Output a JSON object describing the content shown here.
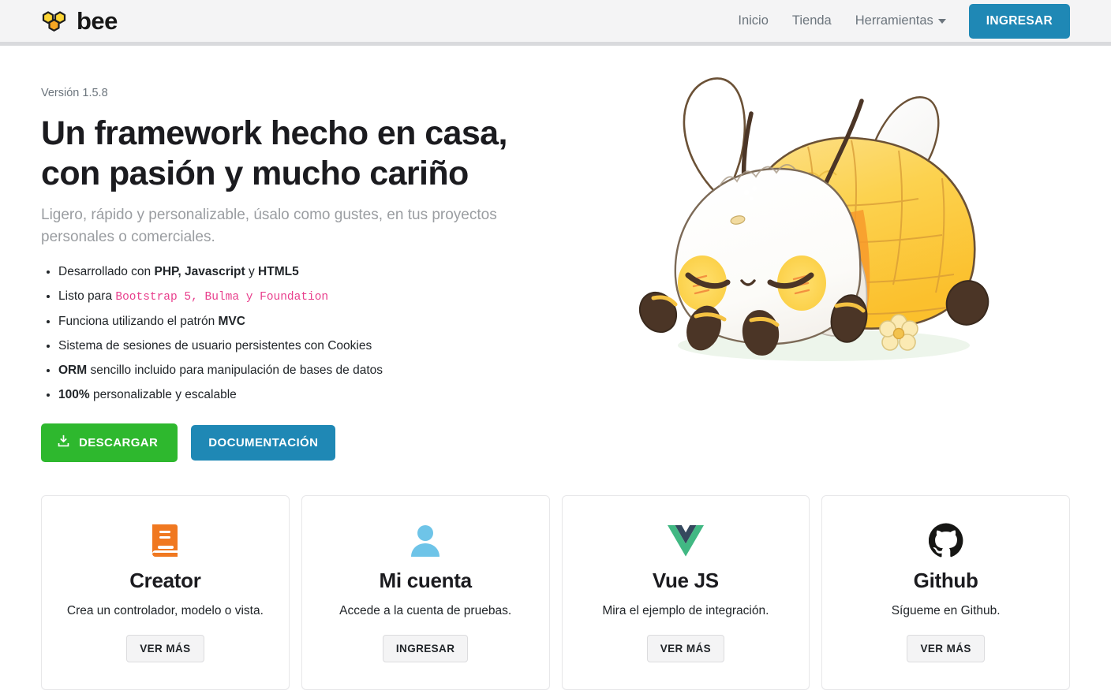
{
  "header": {
    "brand": "bee",
    "brand_logo_icon": "honeycomb-icon",
    "nav": [
      {
        "label": "Inicio"
      },
      {
        "label": "Tienda"
      },
      {
        "label": "Herramientas",
        "has_dropdown": true
      }
    ],
    "login_button": "INGRESAR",
    "login_color": "#1f88b5",
    "background": "#f4f4f5"
  },
  "hero": {
    "version": "Versión 1.5.8",
    "title": "Un framework hecho en casa, con pasión y mucho cariño",
    "subtitle": "Ligero, rápido y personalizable, úsalo como gustes, en tus proyectos personales o comerciales.",
    "features": [
      {
        "before": "Desarrollado con ",
        "bold": "PHP, Javascript",
        "middle": " y ",
        "bold2": "HTML5",
        "after": ""
      },
      {
        "before": "Listo para ",
        "code": "Bootstrap 5, Bulma y Foundation",
        "after": ""
      },
      {
        "before": "Funciona utilizando el patrón ",
        "bold": "MVC",
        "after": ""
      },
      {
        "before": "Sistema de sesiones de usuario persistentes con Cookies",
        "after": ""
      },
      {
        "bold": "ORM",
        "after": " sencillo incluido para manipulación de bases de datos"
      },
      {
        "bold": "100%",
        "after": " personalizable y escalable"
      }
    ],
    "download_button": "DESCARGAR",
    "download_icon": "download-icon",
    "download_color": "#2eb82e",
    "docs_button": "DOCUMENTACIÓN",
    "docs_color": "#1f88b5",
    "illustration": "kawaii-bee-illustration"
  },
  "cards": [
    {
      "icon": "book-icon",
      "icon_color": "#f07820",
      "title": "Creator",
      "text": "Crea un controlador, modelo o vista.",
      "button": "VER MÁS"
    },
    {
      "icon": "user-icon",
      "icon_color": "#6ec4e8",
      "title": "Mi cuenta",
      "text": "Accede a la cuenta de pruebas.",
      "button": "INGRESAR"
    },
    {
      "icon": "vuejs-icon",
      "icon_color": "#41b883",
      "title": "Vue JS",
      "text": "Mira el ejemplo de integración.",
      "button": "VER MÁS"
    },
    {
      "icon": "github-icon",
      "icon_color": "#161614",
      "title": "Github",
      "text": "Sígueme en Github.",
      "button": "VER MÁS"
    }
  ]
}
